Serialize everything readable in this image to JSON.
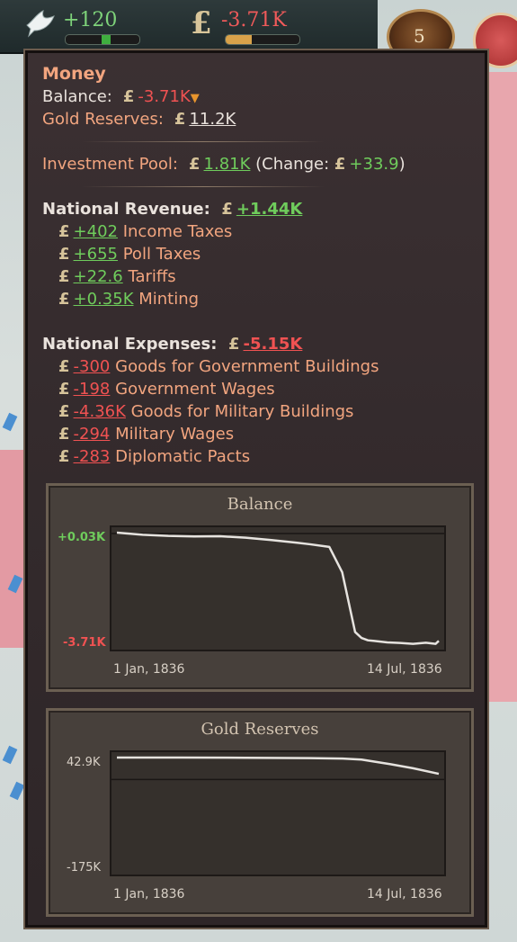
{
  "topbar": {
    "legitimacy_value": "+120",
    "money_value": "-3.71K",
    "medal_number": "5",
    "legitimacy_bar_fraction": 0.12,
    "money_bar_fraction": 0.35
  },
  "tooltip": {
    "title": "Money",
    "balance_label": "Balance:",
    "balance_value": "-3.71K",
    "gold_label": "Gold Reserves:",
    "gold_value": "11.2K",
    "investment_label": "Investment Pool:",
    "investment_value": "1.81K",
    "change_open": "(Change:",
    "change_value": "+33.9",
    "change_close": ")",
    "revenue_label": "National Revenue:",
    "revenue_value": "+1.44K",
    "revenue_items": [
      {
        "value": "+402",
        "label": "Income Taxes"
      },
      {
        "value": "+655",
        "label": "Poll Taxes"
      },
      {
        "value": "+22.6",
        "label": "Tariffs"
      },
      {
        "value": "+0.35K",
        "label": "Minting"
      }
    ],
    "expenses_label": "National Expenses:",
    "expenses_value": "-5.15K",
    "expense_items": [
      {
        "value": "-300",
        "label": "Goods for Government Buildings"
      },
      {
        "value": "-198",
        "label": "Government Wages"
      },
      {
        "value": "-4.36K",
        "label": "Goods for Military Buildings"
      },
      {
        "value": "-294",
        "label": "Military Wages"
      },
      {
        "value": "-283",
        "label": "Diplomatic Pacts"
      }
    ]
  },
  "chart_data": [
    {
      "type": "line",
      "title": "Balance",
      "ytick_top": "+0.03K",
      "ytick_bottom": "-3.71K",
      "xtick_left": "1 Jan, 1836",
      "xtick_right": "14 Jul, 1836",
      "ylim": [
        -3.71,
        0.03
      ],
      "x": [
        0,
        0.08,
        0.16,
        0.24,
        0.32,
        0.4,
        0.48,
        0.56,
        0.6,
        0.66,
        0.7,
        0.74,
        0.76,
        0.78,
        0.8,
        0.84,
        0.88,
        0.92,
        0.96,
        0.99,
        1.0
      ],
      "values": [
        0.03,
        -0.04,
        -0.08,
        -0.1,
        -0.09,
        -0.14,
        -0.22,
        -0.31,
        -0.36,
        -0.45,
        -1.3,
        -3.3,
        -3.5,
        -3.58,
        -3.6,
        -3.65,
        -3.67,
        -3.7,
        -3.66,
        -3.7,
        -3.6
      ],
      "grid": false,
      "baseline": 0
    },
    {
      "type": "line",
      "title": "Gold Reserves",
      "ytick_top": "42.9K",
      "ytick_bottom": "-175K",
      "xtick_left": "1 Jan, 1836",
      "xtick_right": "14 Jul, 1836",
      "ylim": [
        -175,
        42.9
      ],
      "x": [
        0,
        0.2,
        0.4,
        0.6,
        0.7,
        0.76,
        0.85,
        0.92,
        1.0
      ],
      "values": [
        42.9,
        42.9,
        42.5,
        41.8,
        41.0,
        39.0,
        30.0,
        22.0,
        11.2
      ],
      "grid": false,
      "baseline": 0
    }
  ]
}
